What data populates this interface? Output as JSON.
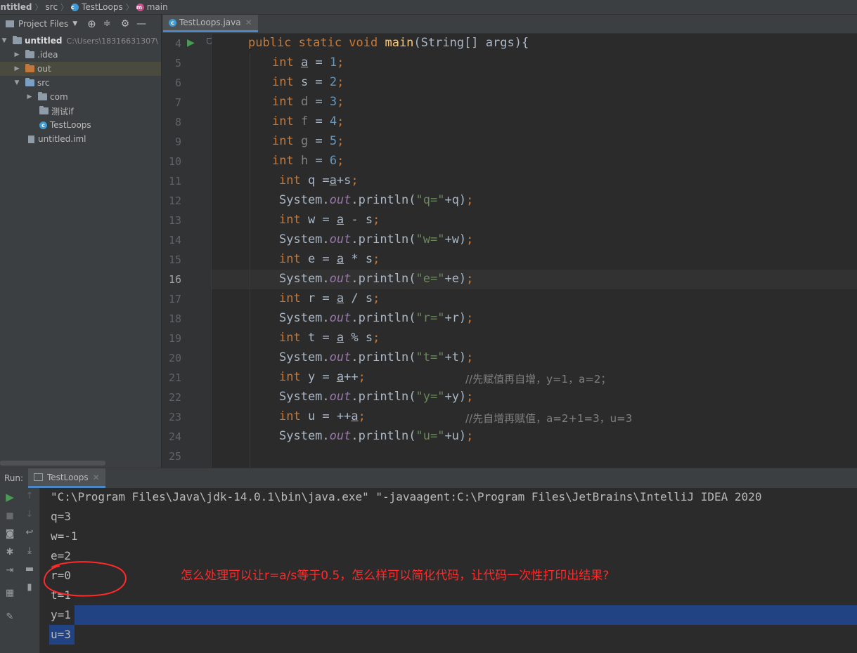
{
  "breadcrumb": {
    "project": "untitled",
    "folder": "src",
    "class_name": "TestLoops",
    "method": "main"
  },
  "project_panel": {
    "view_label": "Project Files",
    "root_name": "untitled",
    "root_path": "C:\\Users\\18316631307\\",
    "items": [
      {
        "label": ".idea"
      },
      {
        "label": "out"
      },
      {
        "label": "src"
      },
      {
        "label": "com"
      },
      {
        "label": "测试if"
      },
      {
        "label": "TestLoops"
      },
      {
        "label": "untitled.iml"
      }
    ]
  },
  "editor": {
    "tab_label": "TestLoops.java",
    "current_line": "16",
    "line_numbers": [
      "4",
      "5",
      "6",
      "7",
      "8",
      "9",
      "10",
      "11",
      "12",
      "13",
      "14",
      "15",
      "16",
      "17",
      "18",
      "19",
      "20",
      "21",
      "22",
      "23",
      "24",
      "25"
    ],
    "comment_1": "//先赋值再自增，y=1，a=2；",
    "comment_2": "//先自增再赋值，a=2+1=3，u=3"
  },
  "run_panel": {
    "run_label": "Run:",
    "tab_label": "TestLoops",
    "command": "\"C:\\Program Files\\Java\\jdk-14.0.1\\bin\\java.exe\" \"-javaagent:C:\\Program Files\\JetBrains\\IntelliJ IDEA 2020",
    "output": [
      "q=3",
      "w=-1",
      "e=2",
      "r=0",
      "t=1",
      "y=1",
      "u=3"
    ]
  },
  "annotation_text": "怎么处理可以让r=a/s等于0.5，怎么样可以简化代码，让代码一次性打印出结果?",
  "colors": {
    "annotation": "#ff2a2a",
    "selection": "#214283",
    "run_green": "#499c54"
  }
}
